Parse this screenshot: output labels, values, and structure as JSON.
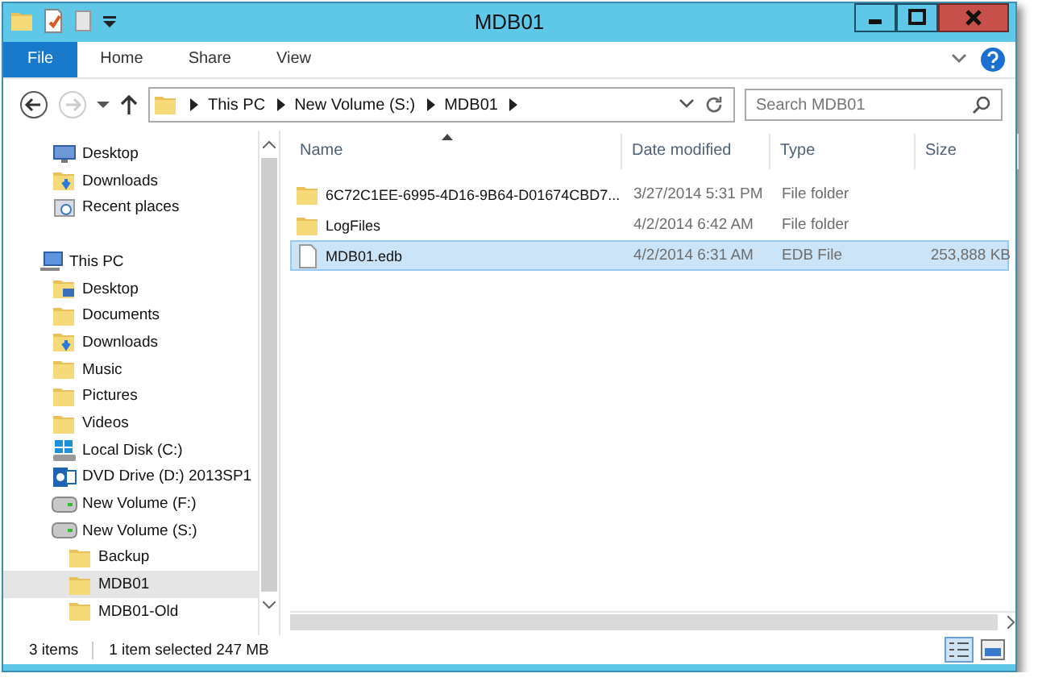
{
  "window": {
    "title": "MDB01"
  },
  "ribbon_tabs": [
    {
      "label": "File",
      "kind": "file",
      "selected": false
    },
    {
      "label": "Home",
      "kind": "tab",
      "selected": false
    },
    {
      "label": "Share",
      "kind": "tab",
      "selected": false
    },
    {
      "label": "View",
      "kind": "tab",
      "selected": false
    }
  ],
  "address_bar": {
    "breadcrumbs": [
      "This PC",
      "New Volume (S:)",
      "MDB01"
    ]
  },
  "search": {
    "placeholder": "Search MDB01"
  },
  "nav_pane": {
    "items": [
      {
        "label": "Desktop",
        "kind": "desktop",
        "selected": false
      },
      {
        "label": "Downloads",
        "kind": "downloads",
        "selected": false
      },
      {
        "label": "Recent places",
        "kind": "recent",
        "selected": false
      },
      {
        "label": "This PC",
        "kind": "pc",
        "selected": false,
        "children": [
          {
            "label": "Desktop",
            "kind": "desktop-folder",
            "selected": false
          },
          {
            "label": "Documents",
            "kind": "folder",
            "selected": false
          },
          {
            "label": "Downloads",
            "kind": "downloads",
            "selected": false
          },
          {
            "label": "Music",
            "kind": "folder",
            "selected": false
          },
          {
            "label": "Pictures",
            "kind": "folder",
            "selected": false
          },
          {
            "label": "Videos",
            "kind": "folder",
            "selected": false
          },
          {
            "label": "Local Disk (C:)",
            "kind": "system-drive",
            "selected": false
          },
          {
            "label": "DVD Drive (D:) 2013SP1",
            "kind": "dvd",
            "selected": false
          },
          {
            "label": "New Volume (F:)",
            "kind": "drive",
            "selected": false
          },
          {
            "label": "New Volume (S:)",
            "kind": "drive",
            "selected": false,
            "children": [
              {
                "label": "Backup",
                "kind": "folder",
                "selected": false
              },
              {
                "label": "MDB01",
                "kind": "folder",
                "selected": true
              },
              {
                "label": "MDB01-Old",
                "kind": "folder",
                "selected": false
              }
            ]
          }
        ]
      }
    ]
  },
  "file_list": {
    "columns": [
      "Name",
      "Date modified",
      "Type",
      "Size"
    ],
    "rows": [
      {
        "name": "6C72C1EE-6995-4D16-9B64-D01674CBD7...",
        "date": "3/27/2014 5:31 PM",
        "type": "File folder",
        "size": "",
        "kind": "folder",
        "selected": false
      },
      {
        "name": "LogFiles",
        "date": "4/2/2014 6:42 AM",
        "type": "File folder",
        "size": "",
        "kind": "folder",
        "selected": false
      },
      {
        "name": "MDB01.edb",
        "date": "4/2/2014 6:31 AM",
        "type": "EDB File",
        "size": "253,888 KB",
        "kind": "file",
        "selected": true
      }
    ]
  },
  "status_bar": {
    "item_count": "3 items",
    "selection": "1 item selected  247 MB"
  }
}
